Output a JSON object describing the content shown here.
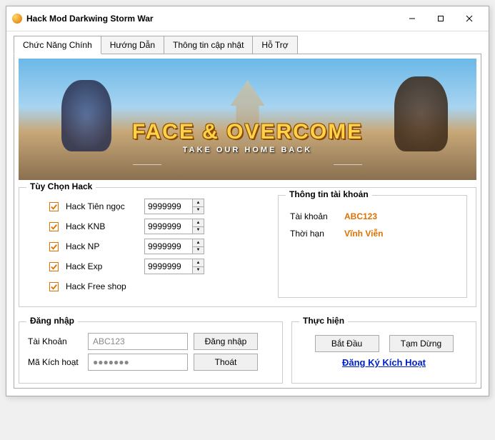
{
  "window": {
    "title": "Hack Mod Darkwing Storm War"
  },
  "tabs": [
    {
      "label": "Chức Năng Chính"
    },
    {
      "label": "Hướng Dẫn"
    },
    {
      "label": "Thông tin cập nhật"
    },
    {
      "label": "Hỗ Trợ"
    }
  ],
  "banner": {
    "title": "FACE & OVERCOME",
    "subtitle": "TAKE OUR HOME BACK"
  },
  "hackOptions": {
    "title": "Tùy Chọn Hack",
    "items": [
      {
        "label": "Hack Tiên ngọc",
        "value": "9999999"
      },
      {
        "label": "Hack KNB",
        "value": "9999999"
      },
      {
        "label": "Hack NP",
        "value": "9999999"
      },
      {
        "label": "Hack Exp",
        "value": "9999999"
      },
      {
        "label": "Hack Free shop",
        "value": ""
      }
    ]
  },
  "accountInfo": {
    "title": "Thông tin tài khoản",
    "lines": [
      {
        "label": "Tài khoản",
        "value": "ABC123"
      },
      {
        "label": "Thời hạn",
        "value": "Vĩnh Viễn"
      }
    ]
  },
  "login": {
    "title": "Đăng nhập",
    "accountLabel": "Tài Khoản",
    "accountValue": "ABC123",
    "keyLabel": "Mã Kích hoạt",
    "keyValue": "●●●●●●●",
    "loginBtn": "Đăng nhập",
    "exitBtn": "Thoát"
  },
  "exec": {
    "title": "Thực hiện",
    "startBtn": "Bắt Đầu",
    "pauseBtn": "Tạm Dừng",
    "link": "Đăng Ký Kích Hoạt"
  }
}
